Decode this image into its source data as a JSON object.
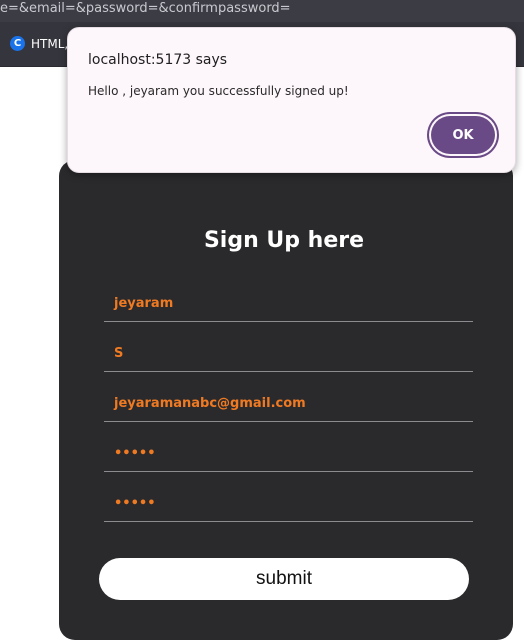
{
  "browser": {
    "url_text": "e=&email=&password=&confirmpassword=",
    "bookmark": {
      "icon_letter": "C",
      "label": "HTML,"
    }
  },
  "form": {
    "title": "Sign Up here",
    "fields": [
      {
        "name": "first-name",
        "value": "jeyaram"
      },
      {
        "name": "last-name",
        "value": "S"
      },
      {
        "name": "email",
        "value": "jeyaramanabc@gmail.com"
      },
      {
        "name": "password",
        "value": "•••••"
      },
      {
        "name": "confirm-password",
        "value": "•••••"
      }
    ],
    "submit_label": "submit"
  },
  "dialog": {
    "title": "localhost:5173 says",
    "message": "Hello , jeyaram you successfully signed up!",
    "ok_label": "OK"
  },
  "colors": {
    "card_background": "#2a2a2d",
    "field_text": "#f07a22",
    "ok_button": "#6a4a86"
  }
}
